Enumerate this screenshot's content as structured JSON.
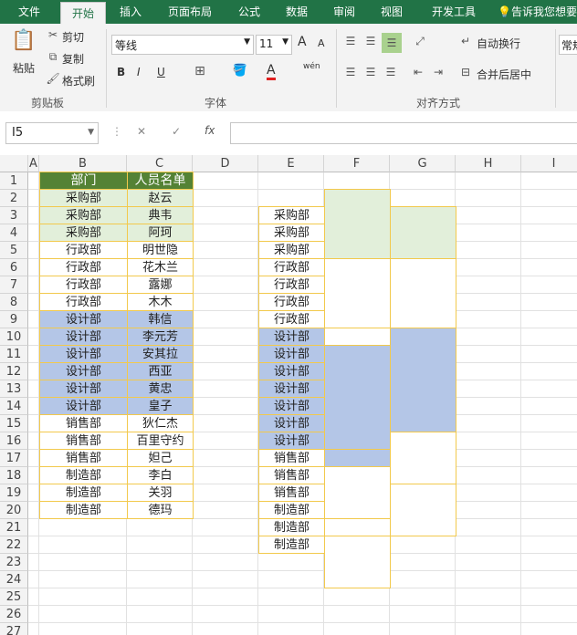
{
  "tabs": [
    "文件",
    "开始",
    "插入",
    "页面布局",
    "公式",
    "数据",
    "审阅",
    "视图",
    "开发工具"
  ],
  "tellme": "告诉我您想要",
  "ribbon": {
    "paste": "粘贴",
    "cut": "剪切",
    "copy": "复制",
    "format_painter": "格式刷",
    "clipboard_group": "剪贴板",
    "font_name": "等线",
    "font_size": "11",
    "font_group": "字体",
    "bold": "B",
    "italic": "I",
    "underline": "U",
    "grow": "A",
    "shrink": "A",
    "font_color": "A",
    "wen": "wén",
    "wrap_text": "自动换行",
    "merge_center": "合并后居中",
    "align_group": "对齐方式",
    "number_format": "常规"
  },
  "formula_bar": {
    "name_box": "I5",
    "cancel": "✕",
    "enter": "✓",
    "fx": "fx",
    "value": ""
  },
  "columns": [
    "A",
    "B",
    "C",
    "D",
    "E",
    "F",
    "G",
    "H",
    "I"
  ],
  "rows": [
    "1",
    "2",
    "3",
    "4",
    "5",
    "6",
    "7",
    "8",
    "9",
    "10",
    "11",
    "12",
    "13",
    "14",
    "15",
    "16",
    "17",
    "18",
    "19",
    "20",
    "21",
    "22",
    "23",
    "24",
    "25",
    "26",
    "27"
  ],
  "colors": {
    "green_header": "#548235",
    "light_green": "#e2efda",
    "blue": "#b4c6e7",
    "border": "#f2c94c",
    "excel_green": "#217346"
  },
  "table_bc": {
    "headers": [
      "部门",
      "人员名单"
    ],
    "rows": [
      [
        "采购部",
        "赵云"
      ],
      [
        "采购部",
        "典韦"
      ],
      [
        "采购部",
        "阿珂"
      ],
      [
        "行政部",
        "明世隐"
      ],
      [
        "行政部",
        "花木兰"
      ],
      [
        "行政部",
        "露娜"
      ],
      [
        "行政部",
        "木木"
      ],
      [
        "设计部",
        "韩信"
      ],
      [
        "设计部",
        "李元芳"
      ],
      [
        "设计部",
        "安其拉"
      ],
      [
        "设计部",
        "西亚"
      ],
      [
        "设计部",
        "黄忠"
      ],
      [
        "设计部",
        "皇子"
      ],
      [
        "销售部",
        "狄仁杰"
      ],
      [
        "销售部",
        "百里守约"
      ],
      [
        "销售部",
        "妲己"
      ],
      [
        "制造部",
        "李白"
      ],
      [
        "制造部",
        "关羽"
      ],
      [
        "制造部",
        "德玛"
      ]
    ]
  },
  "column_e": [
    "采购部",
    "采购部",
    "采购部",
    "行政部",
    "行政部",
    "行政部",
    "行政部",
    "设计部",
    "设计部",
    "设计部",
    "设计部",
    "设计部",
    "设计部",
    "设计部",
    "销售部",
    "销售部",
    "销售部",
    "制造部",
    "制造部",
    "制造部"
  ]
}
